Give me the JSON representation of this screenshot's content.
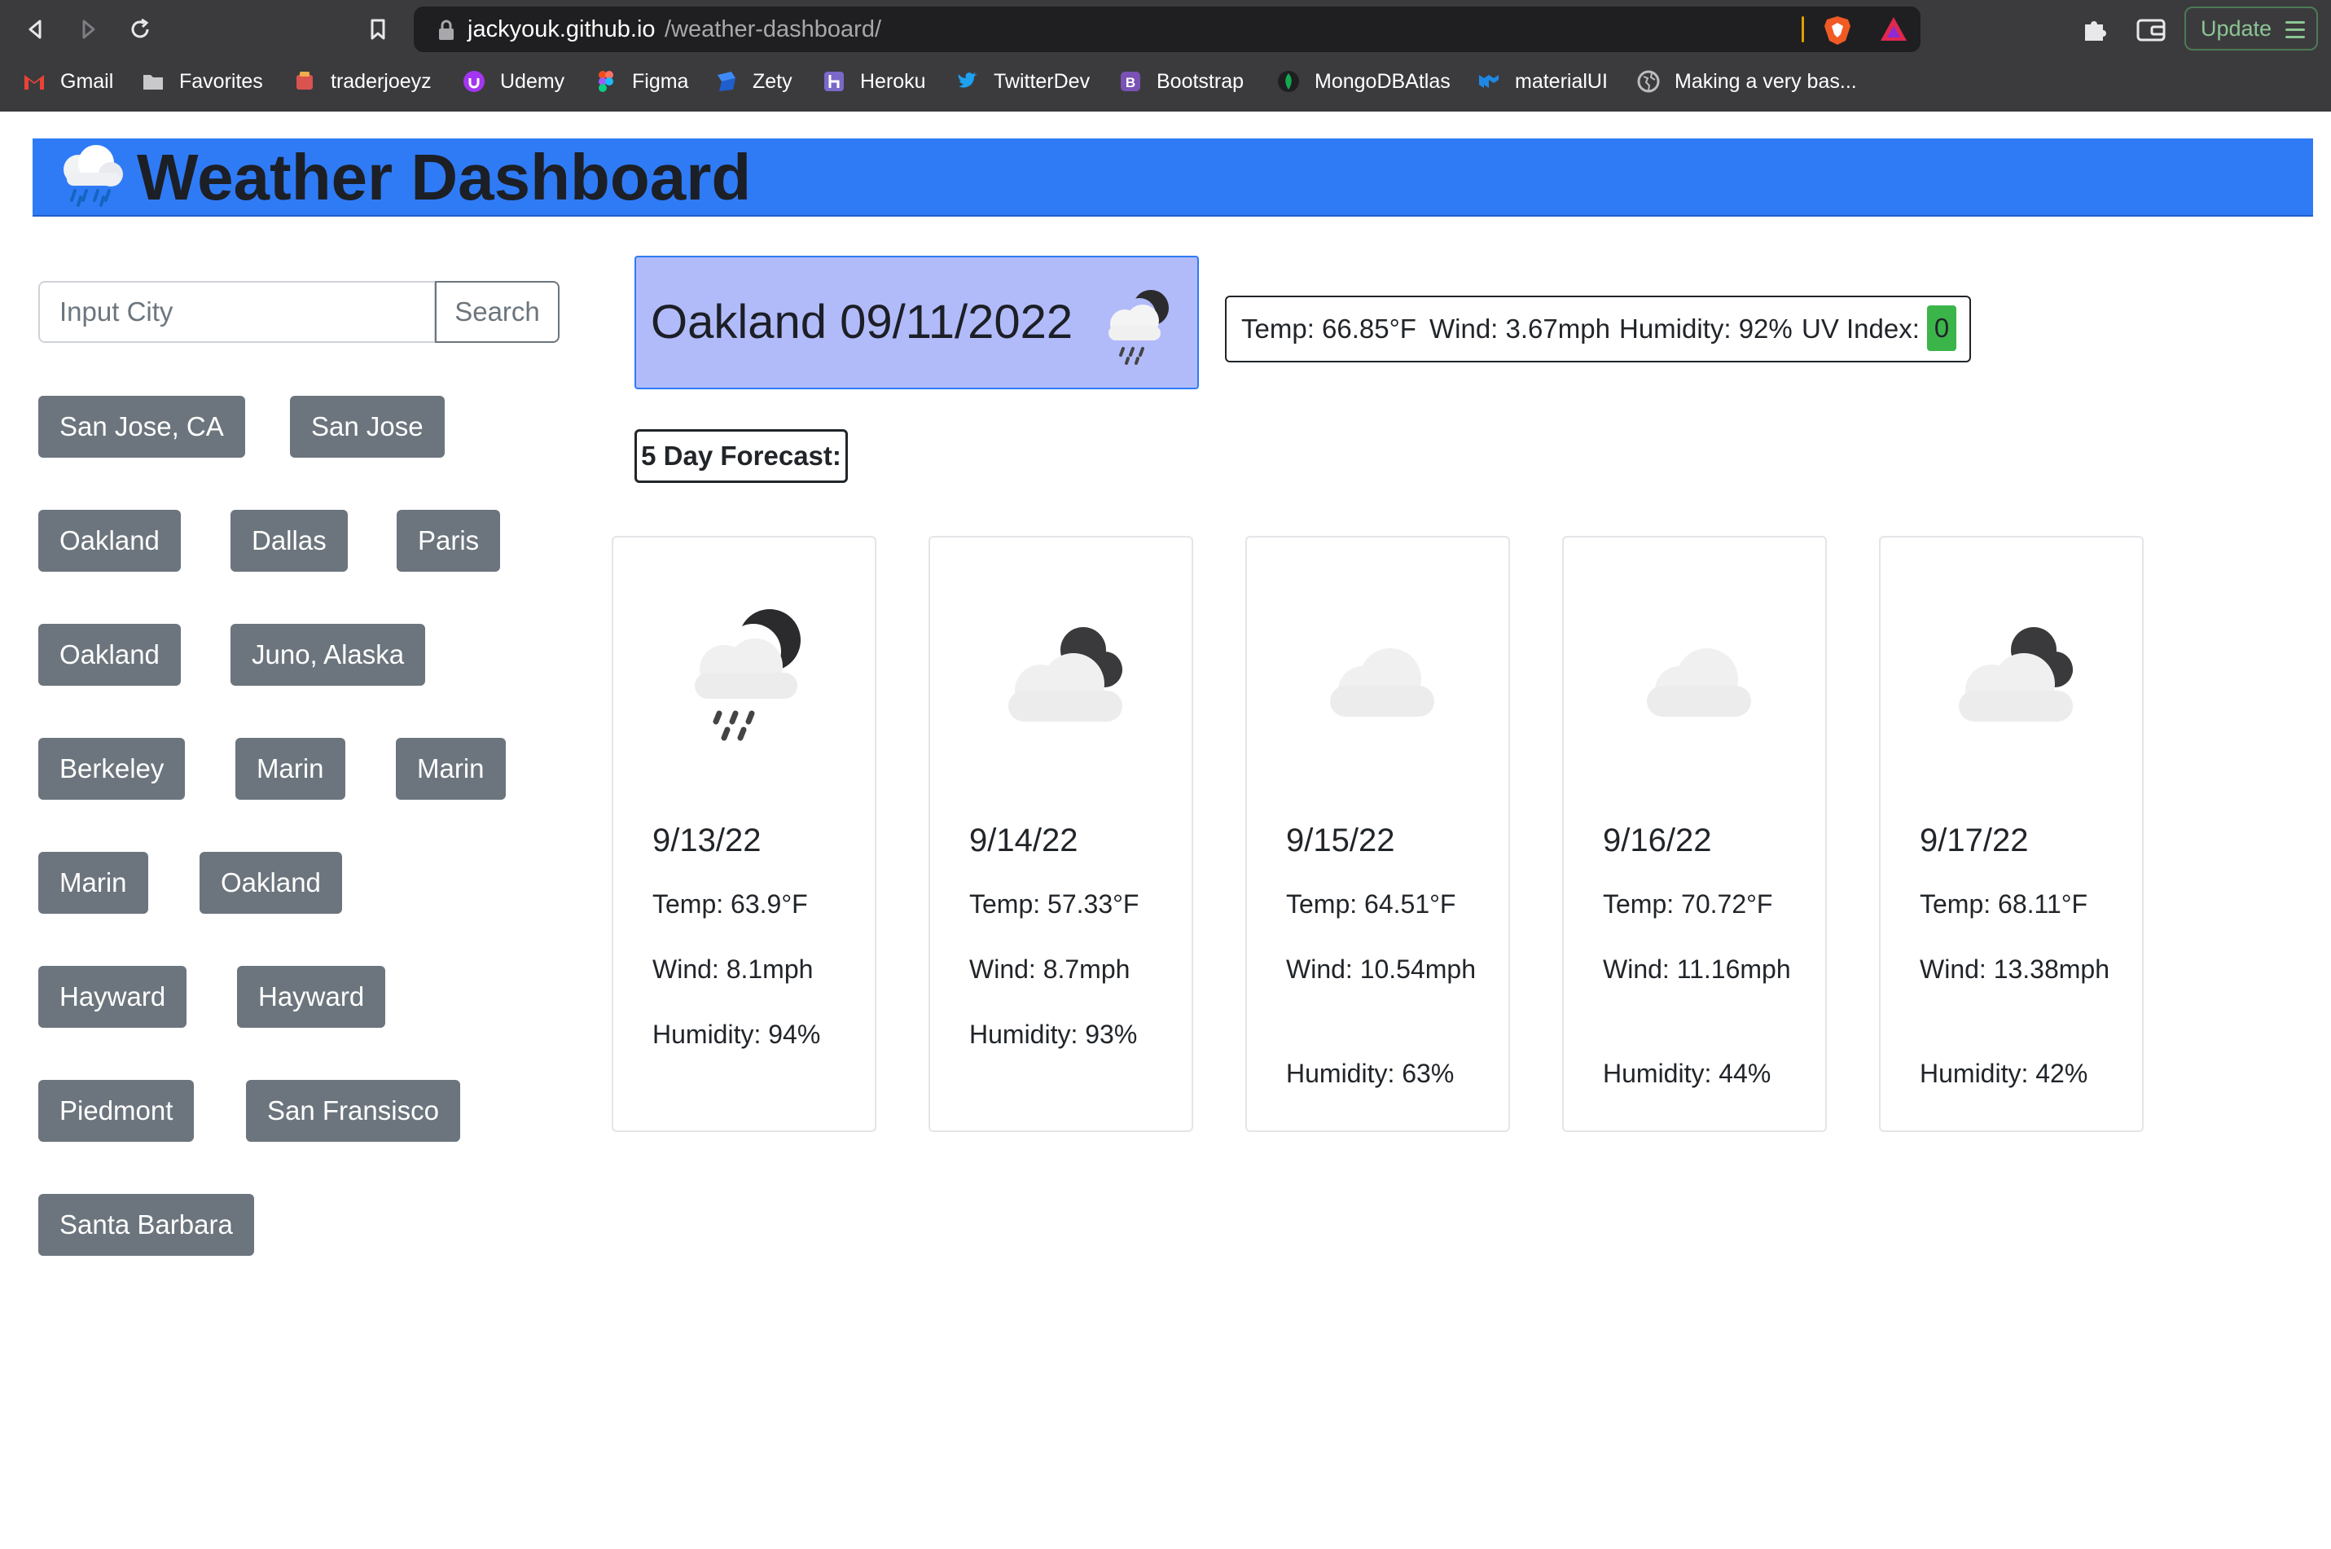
{
  "browser": {
    "url_host": "jackyouk.github.io",
    "url_path": "/weather-dashboard/",
    "update_label": "Update",
    "bookmarks": [
      {
        "label": "Gmail",
        "icon": "gmail-icon"
      },
      {
        "label": "Favorites",
        "icon": "folder-icon"
      },
      {
        "label": "traderjoeyz",
        "icon": "traderjoeyz-icon"
      },
      {
        "label": "Udemy",
        "icon": "udemy-icon"
      },
      {
        "label": "Figma",
        "icon": "figma-icon"
      },
      {
        "label": "Zety",
        "icon": "zety-icon"
      },
      {
        "label": "Heroku",
        "icon": "heroku-icon"
      },
      {
        "label": "TwitterDev",
        "icon": "twitter-icon"
      },
      {
        "label": "Bootstrap",
        "icon": "bootstrap-icon"
      },
      {
        "label": "MongoDBAtlas",
        "icon": "mongodb-icon"
      },
      {
        "label": "materialUI",
        "icon": "materialui-icon"
      },
      {
        "label": "Making a very bas...",
        "icon": "globe-icon"
      }
    ]
  },
  "header": {
    "title": "Weather Dashboard",
    "emoji_icon": "cloud-rain-icon",
    "color": "#2f7bf6"
  },
  "search": {
    "placeholder": "Input City",
    "button_label": "Search"
  },
  "history": [
    "San Jose, CA",
    "San Jose",
    "Oakland",
    "Dallas",
    "Paris",
    "Oakland",
    "Juno, Alaska",
    "Berkeley",
    "Marin",
    "Marin",
    "Marin",
    "Oakland",
    "Hayward",
    "Hayward",
    "Piedmont",
    "San Fransisco",
    "Santa Barbara"
  ],
  "current": {
    "title": "Oakland 09/11/2022",
    "icon": "night-rain-cloud-icon",
    "temp": "Temp: 66.85°F",
    "wind": "Wind: 3.67mph",
    "humidity": "Humidity: 92%",
    "uv_label": "UV Index:",
    "uv_value": "0",
    "uv_color": "#3bb54a"
  },
  "forecast_label": "5 Day Forecast:",
  "forecast": [
    {
      "date": "9/13/22",
      "temp": "Temp: 63.9°F",
      "wind": "Wind: 8.1mph",
      "humidity": "Humidity: 94%",
      "icon": "night-rain-cloud-icon"
    },
    {
      "date": "9/14/22",
      "temp": "Temp: 57.33°F",
      "wind": "Wind: 8.7mph",
      "humidity": "Humidity: 93%",
      "icon": "night-broken-clouds-icon"
    },
    {
      "date": "9/15/22",
      "temp": "Temp: 64.51°F",
      "wind": "Wind: 10.54mph",
      "humidity": "Humidity: 63%",
      "icon": "cloud-icon"
    },
    {
      "date": "9/16/22",
      "temp": "Temp: 70.72°F",
      "wind": "Wind: 11.16mph",
      "humidity": "Humidity: 44%",
      "icon": "cloud-icon"
    },
    {
      "date": "9/17/22",
      "temp": "Temp: 68.11°F",
      "wind": "Wind: 13.38mph",
      "humidity": "Humidity: 42%",
      "icon": "night-broken-clouds-icon"
    }
  ]
}
